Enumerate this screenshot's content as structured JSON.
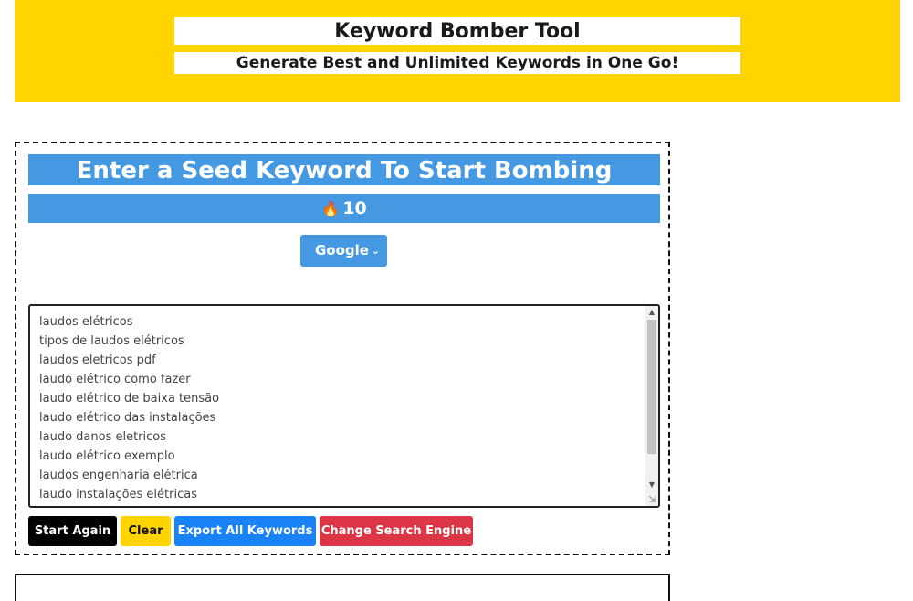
{
  "header": {
    "title": "Keyword Bomber Tool",
    "subtitle": "Generate Best and Unlimited Keywords in One Go!"
  },
  "tool": {
    "banner": "Enter a Seed Keyword To Start Bombing",
    "counter_icon": "flame-icon",
    "counter": "10",
    "engine_select": {
      "selected": "Google"
    },
    "keywords": [
      "laudos elétricos",
      "tipos de laudos elétricos",
      "laudos eletricos pdf",
      "laudo elétrico como fazer",
      "laudo elétrico de baixa tensão",
      "laudo elétrico das instalações",
      "laudo danos eletricos",
      "laudo elétrico exemplo",
      "laudos engenharia elétrica",
      "laudo instalações elétricas"
    ],
    "buttons": {
      "start_again": "Start Again",
      "clear": "Clear",
      "export": "Export All Keywords",
      "change_engine": "Change Search Engine"
    }
  },
  "colors": {
    "header_bg": "#ffd400",
    "banner_bg": "#4599e3",
    "export_bg": "#1a82f7",
    "change_bg": "#dc3545"
  }
}
